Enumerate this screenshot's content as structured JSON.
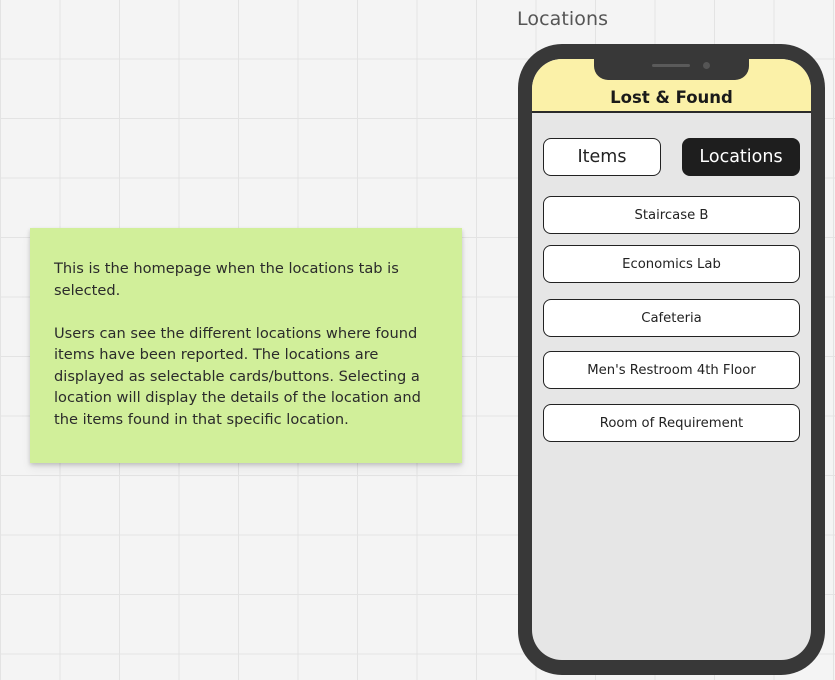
{
  "frame": {
    "title": "Locations"
  },
  "note": {
    "paragraph1": "This is the homepage when the locations tab is selected.",
    "paragraph2": "Users can see the different locations where found items have been reported. The locations are displayed as selectable cards/buttons. Selecting a location will display the details of the location and the items found in that specific location."
  },
  "app": {
    "title": "Lost & Found",
    "tabs": [
      {
        "label": "Items",
        "active": false
      },
      {
        "label": "Locations",
        "active": true
      }
    ],
    "locations": [
      {
        "name": "Staircase B"
      },
      {
        "name": "Economics Lab"
      },
      {
        "name": "Cafeteria"
      },
      {
        "name": "Men's Restroom 4th Floor"
      },
      {
        "name": "Room of Requirement"
      }
    ]
  },
  "colors": {
    "note_background": "#d1ef9a",
    "header_background": "#fbf1a8",
    "phone_body": "#383838",
    "active_tab": "#1e1e1e"
  }
}
